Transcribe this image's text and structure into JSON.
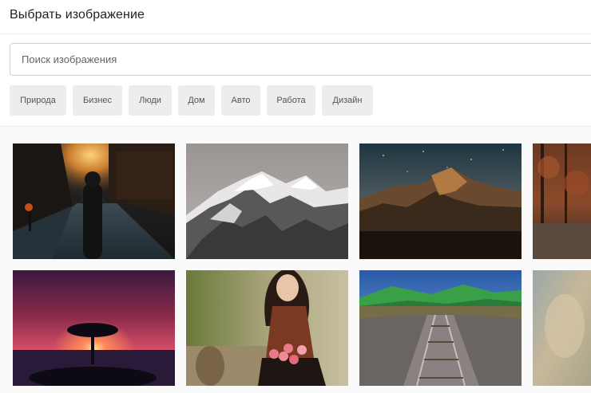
{
  "header": {
    "title": "Выбрать изображение"
  },
  "search": {
    "placeholder": "Поиск изображения"
  },
  "categories": [
    "Природа",
    "Бизнес",
    "Люди",
    "Дом",
    "Авто",
    "Работа",
    "Дизайн"
  ],
  "images": [
    {
      "name": "city-street-night-image"
    },
    {
      "name": "snowy-mountains-image"
    },
    {
      "name": "mountain-starry-sky-image"
    },
    {
      "name": "autumn-forest-image"
    },
    {
      "name": "tree-sunset-silhouette-image"
    },
    {
      "name": "woman-with-tulips-image"
    },
    {
      "name": "railway-bridge-image"
    },
    {
      "name": "blurred-image"
    }
  ]
}
